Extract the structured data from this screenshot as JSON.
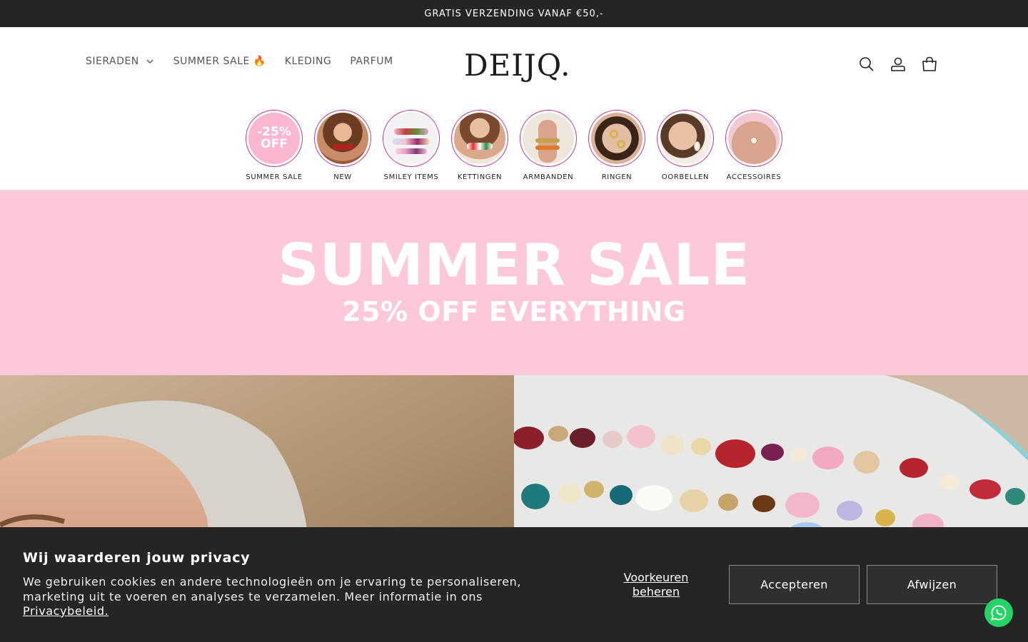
{
  "announcement": {
    "text": "GRATIS VERZENDING VANAF €50,-"
  },
  "header": {
    "logo": "DEIJQ.",
    "nav": [
      {
        "label": "SIERADEN",
        "has_dropdown": true
      },
      {
        "label": "SUMMER SALE 🔥",
        "has_dropdown": false
      },
      {
        "label": "KLEDING",
        "has_dropdown": false
      },
      {
        "label": "PARFUM",
        "has_dropdown": false
      }
    ],
    "icons": [
      "search-icon",
      "account-icon",
      "cart-icon"
    ]
  },
  "categories": [
    {
      "label": "SUMMER SALE",
      "badge": "-25%\nOFF"
    },
    {
      "label": "NEW"
    },
    {
      "label": "SMILEY ITEMS"
    },
    {
      "label": "KETTINGEN"
    },
    {
      "label": "ARMBANDEN"
    },
    {
      "label": "RINGEN"
    },
    {
      "label": "OORBELLEN"
    },
    {
      "label": "ACCESSOIRES"
    }
  ],
  "hero": {
    "title": "SUMMER SALE",
    "subtitle": "25% OFF EVERYTHING",
    "background": "#fdc8d9"
  },
  "cookie": {
    "title": "Wij waarderen jouw privacy",
    "text": "We gebruiken cookies en andere technologieën om je ervaring te personaliseren, marketing uit te voeren en analyses te verzamelen. Meer informatie in ons",
    "link": "Privacybeleid.",
    "preferences": "Voorkeuren beheren",
    "accept": "Accepteren",
    "reject": "Afwijzen"
  },
  "colors": {
    "accent_ring": "#c13a8f",
    "dark": "#252525",
    "whatsapp": "#25d366"
  }
}
